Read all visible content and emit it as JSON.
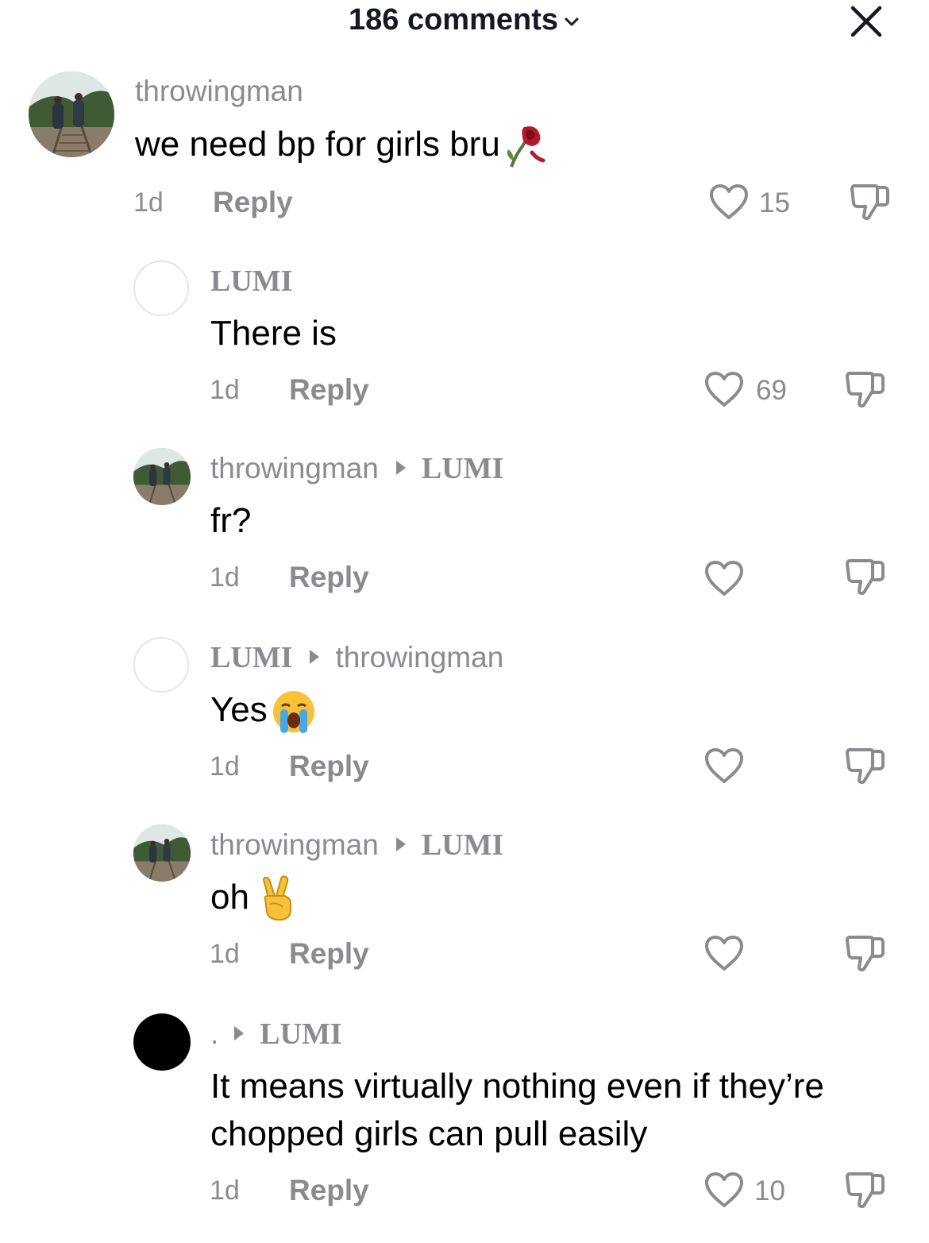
{
  "header": {
    "title": "186 comments"
  },
  "comments": [
    {
      "user": "throwingman",
      "reply_to": "",
      "text": "we need bp for girls bru",
      "emoji": "wilted-rose-icon",
      "age": "1d",
      "reply_label": "Reply",
      "likes": "15"
    },
    {
      "user": "LUMI",
      "reply_to": "",
      "text": "There is",
      "age": "1d",
      "reply_label": "Reply",
      "likes": "69"
    },
    {
      "user": "throwingman",
      "reply_to": "LUMI",
      "text": "fr?",
      "age": "1d",
      "reply_label": "Reply",
      "likes": ""
    },
    {
      "user": "LUMI",
      "reply_to": "throwingman",
      "text": "Yes",
      "emoji": "crying-face-icon",
      "age": "1d",
      "reply_label": "Reply",
      "likes": ""
    },
    {
      "user": "throwingman",
      "reply_to": "LUMI",
      "text": "oh",
      "emoji": "victory-hand-icon",
      "age": "1d",
      "reply_label": "Reply",
      "likes": ""
    },
    {
      "user": ".",
      "reply_to": "LUMI",
      "text_line1": "It means virtually nothing even if they’re",
      "text_line2": "chopped girls can pull easily",
      "age": "1d",
      "reply_label": "Reply",
      "likes": "10"
    }
  ],
  "colors": {
    "muted": "#8a8b91",
    "text": "#000000"
  }
}
